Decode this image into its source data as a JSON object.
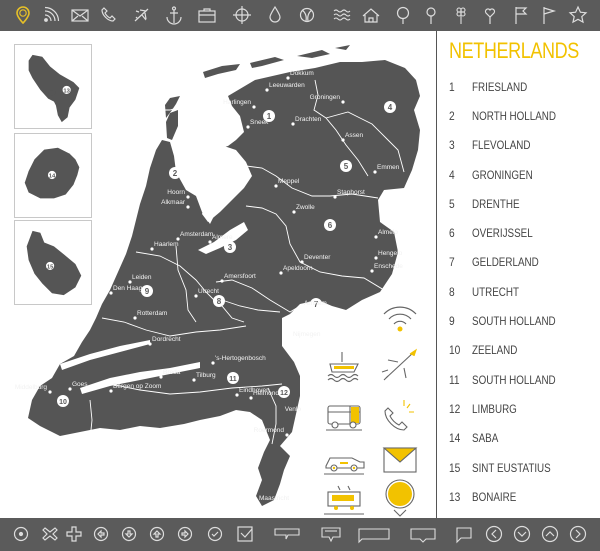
{
  "colors": {
    "bar_bg": "#5b5b5b",
    "map_fill": "#555555",
    "accent": "#f2c200",
    "text": "#444444",
    "border_line": "#ffffff"
  },
  "top_toolbar": {
    "icons": [
      {
        "name": "location-pin-icon",
        "active": true
      },
      {
        "name": "rss-icon"
      },
      {
        "name": "envelope-icon"
      },
      {
        "name": "phone-icon"
      },
      {
        "name": "airplane-icon"
      },
      {
        "name": "anchor-icon"
      },
      {
        "name": "briefcase-icon"
      },
      {
        "name": "compass-icon"
      },
      {
        "name": "water-drop-icon"
      },
      {
        "name": "globe-icon"
      },
      {
        "name": "waves-icon"
      },
      {
        "name": "home-icon"
      },
      {
        "name": "round-pin-icon"
      },
      {
        "name": "small-pin-icon"
      },
      {
        "name": "clover-pin-icon"
      },
      {
        "name": "heart-pin-icon"
      },
      {
        "name": "flag-icon"
      },
      {
        "name": "pennant-flag-icon"
      },
      {
        "name": "star-icon"
      }
    ]
  },
  "bottom_toolbar": {
    "icons": [
      {
        "name": "radio-dot-icon"
      },
      {
        "name": "close-x-icon"
      },
      {
        "name": "plus-icon"
      },
      {
        "name": "arrow-left-circle-icon"
      },
      {
        "name": "arrow-down-circle-icon"
      },
      {
        "name": "arrow-up-circle-icon"
      },
      {
        "name": "arrow-right-circle-icon"
      },
      {
        "name": "check-circle-icon"
      },
      {
        "name": "checkbox-icon"
      },
      {
        "name": "speech-bubble-icon"
      },
      {
        "name": "speech-bubble-small-icon"
      },
      {
        "name": "speech-bubble-wide-icon"
      },
      {
        "name": "speech-bubble-center-icon"
      },
      {
        "name": "speech-bubble-square-icon"
      },
      {
        "name": "chevron-left-circle-icon"
      },
      {
        "name": "chevron-down-circle-icon"
      },
      {
        "name": "chevron-up-circle-icon"
      },
      {
        "name": "chevron-right-circle-icon"
      }
    ]
  },
  "legend": {
    "title": "NETHERLANDS",
    "items": [
      {
        "num": "1",
        "name": "FRIESLAND"
      },
      {
        "num": "2",
        "name": "NORTH HOLLAND"
      },
      {
        "num": "3",
        "name": "FLEVOLAND"
      },
      {
        "num": "4",
        "name": "GRONINGEN"
      },
      {
        "num": "5",
        "name": "DRENTHE"
      },
      {
        "num": "6",
        "name": "OVERIJSSEL"
      },
      {
        "num": "7",
        "name": "GELDERLAND"
      },
      {
        "num": "8",
        "name": "UTRECHT"
      },
      {
        "num": "9",
        "name": "SOUTH HOLLAND"
      },
      {
        "num": "10",
        "name": "ZEELAND"
      },
      {
        "num": "11",
        "name": "SOUTH HOLLAND"
      },
      {
        "num": "12",
        "name": "LIMBURG"
      },
      {
        "num": "14",
        "name": "SABA"
      },
      {
        "num": "15",
        "name": "SINT EUSTATIUS"
      },
      {
        "num": "13",
        "name": "BONAIRE"
      }
    ]
  },
  "map": {
    "province_markers": [
      "1",
      "2",
      "3",
      "4",
      "5",
      "6",
      "7",
      "8",
      "9",
      "10",
      "11",
      "12"
    ],
    "inset_markers": [
      "13",
      "14",
      "15"
    ],
    "cities": [
      "Dokkum",
      "Leeuwarden",
      "Harlingen",
      "Sneek",
      "Drachten",
      "Groningen",
      "Assen",
      "Emmen",
      "Meppel",
      "Staphorst",
      "Zwolle",
      "Almelo",
      "Hengelo",
      "Enschede",
      "Deventer",
      "Apeldoorn",
      "Hoorn",
      "Alkmaar",
      "Amsterdam",
      "Haarlem",
      "Almere",
      "Amersfoort",
      "Leiden",
      "Den Haag",
      "Utrecht",
      "Arnhem",
      "Rotterdam",
      "Nijmegen",
      "Dordrecht",
      "'s-Hertogenbosch",
      "Breda",
      "Tilburg",
      "Bergen op Zoom",
      "Middelburg",
      "Goes",
      "Eindhoven",
      "Helmond",
      "Venlo",
      "Roermond",
      "Maastricht"
    ]
  },
  "transport_icons": [
    {
      "name": "wifi-icon"
    },
    {
      "name": "ship-icon"
    },
    {
      "name": "airplane-icon"
    },
    {
      "name": "bus-icon"
    },
    {
      "name": "phone-ringing-icon"
    },
    {
      "name": "taxi-icon"
    },
    {
      "name": "mail-icon"
    },
    {
      "name": "tram-icon"
    },
    {
      "name": "location-pin-icon"
    }
  ]
}
